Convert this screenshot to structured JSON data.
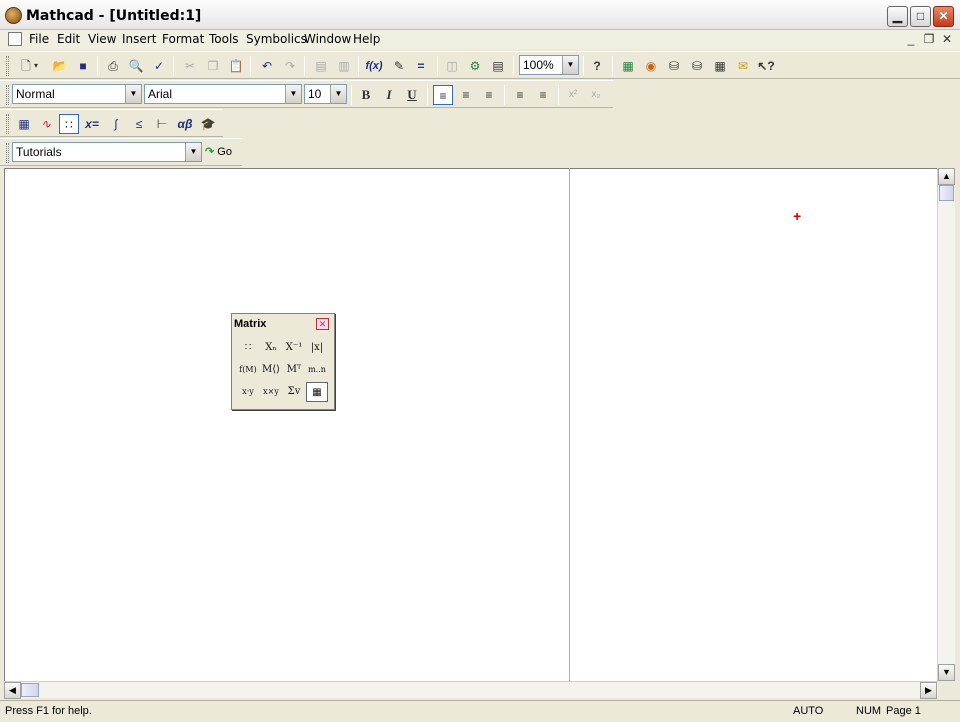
{
  "window": {
    "title": "Mathcad - [Untitled:1]",
    "caption_buttons": {
      "minimize": "▁",
      "maximize": "□",
      "close": "✕"
    }
  },
  "menubar": {
    "items": [
      "File",
      "Edit",
      "View",
      "Insert",
      "Format",
      "Tools",
      "Symbolics",
      "Window",
      "Help"
    ],
    "mdi_buttons": {
      "minimize": "_",
      "restore": "❐",
      "close": "✕"
    }
  },
  "standard_toolbar": {
    "zoom": "100%",
    "buttons": [
      "new-icon",
      "open-icon",
      "save-icon",
      "print-icon",
      "print-preview-icon",
      "spell-check-icon",
      "cut-icon",
      "copy-icon",
      "paste-icon",
      "undo-icon",
      "redo-icon",
      "align-icon",
      "align-down-icon",
      "insert-function-icon",
      "insert-unit-icon",
      "calculate-icon",
      "include-icon",
      "insert-component-icon",
      "region-icon",
      "help-icon",
      "resource-center-icon",
      "web-icon",
      "collaboratory-icon",
      "quicksheets-icon",
      "video-icon",
      "context-help-icon"
    ]
  },
  "formatting_toolbar": {
    "style": "Normal",
    "font": "Arial",
    "size": "10",
    "bold": "B",
    "italic": "I",
    "underline": "U",
    "superscript": "x²",
    "subscript": "x₂"
  },
  "math_toolbar": {
    "buttons": [
      "calculator-icon",
      "graph-icon",
      "matrix-icon",
      "evaluation-icon",
      "calculus-icon",
      "boolean-icon",
      "programming-icon",
      "greek-icon",
      "symbolic-icon"
    ],
    "labels": {
      "evaluation": "x=",
      "greek": "αβ"
    }
  },
  "resources_toolbar": {
    "selected": "Tutorials",
    "go_label": "Go"
  },
  "matrix_palette": {
    "title": "Matrix",
    "cells": [
      "∷",
      "Xₙ",
      "X⁻¹",
      "|x|",
      "f(M)",
      "M⟨⟩",
      "Mᵀ",
      "m..n",
      "x·y",
      "x×y",
      "Σv",
      "▦"
    ]
  },
  "statusbar": {
    "message": "Press F1 for help.",
    "mode": "AUTO",
    "num": "NUM",
    "page": "Page 1"
  }
}
